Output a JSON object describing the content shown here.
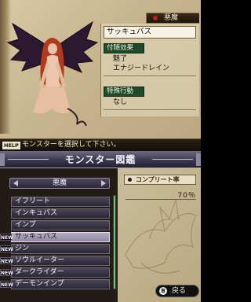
{
  "top": {
    "category": "悪魔",
    "monster_name": "サッキュバス",
    "sections": {
      "effects_label": "付随効果",
      "effects": [
        "魅了",
        "エナジードレイン"
      ],
      "special_label": "特殊行動",
      "special": "なし"
    },
    "help": {
      "badge": "HELP",
      "text": "モンスターを選択して下さい。"
    }
  },
  "bottom": {
    "title": "モンスター図鑑",
    "category_selector": "悪魔",
    "completion": {
      "label": "コンプリート率",
      "value": "70％",
      "percent": 70
    },
    "list": [
      {
        "name": "イフリート",
        "new": false,
        "selected": false
      },
      {
        "name": "インキュバス",
        "new": false,
        "selected": false
      },
      {
        "name": "インプ",
        "new": false,
        "selected": false
      },
      {
        "name": "サッキュバス",
        "new": true,
        "selected": true
      },
      {
        "name": "ジン",
        "new": true,
        "selected": false
      },
      {
        "name": "ソウルイーター",
        "new": true,
        "selected": false
      },
      {
        "name": "ダークライダー",
        "new": true,
        "selected": false
      },
      {
        "name": "デーモンインプ",
        "new": true,
        "selected": false
      }
    ],
    "new_badge": "NEW",
    "back": {
      "icon": "B",
      "label": "戻る"
    }
  },
  "colors": {
    "selection": "#b4aec4",
    "scroll_thumb": "#5fc85a",
    "section_label_bg": "#1e4a2a"
  }
}
